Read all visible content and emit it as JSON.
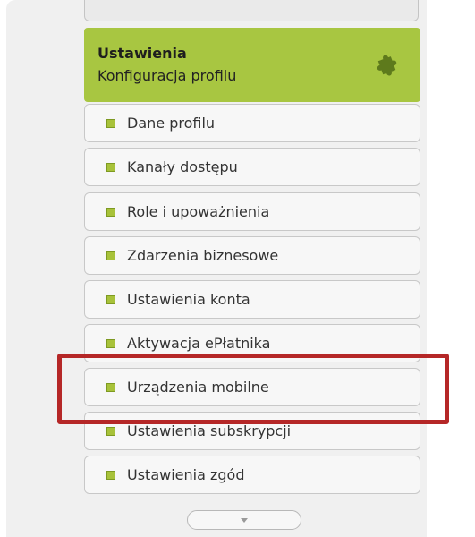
{
  "section": {
    "title": "Ustawienia",
    "subtitle": "Konfiguracja profilu",
    "icon": "puzzle-icon",
    "color": "#a8c641"
  },
  "menu": {
    "items": [
      {
        "label": "Dane profilu",
        "icon": "bullet-icon"
      },
      {
        "label": "Kanały dostępu",
        "icon": "bullet-icon"
      },
      {
        "label": "Role i upoważnienia",
        "icon": "bullet-icon"
      },
      {
        "label": "Zdarzenia biznesowe",
        "icon": "bullet-icon"
      },
      {
        "label": "Ustawienia konta",
        "icon": "bullet-icon"
      },
      {
        "label": "Aktywacja ePłatnika",
        "icon": "bullet-icon"
      },
      {
        "label": "Urządzenia mobilne",
        "icon": "bullet-icon"
      },
      {
        "label": "Ustawienia subskrypcji",
        "icon": "bullet-icon"
      },
      {
        "label": "Ustawienia zgód",
        "icon": "bullet-icon"
      }
    ],
    "highlighted_item": "Urządzenia mobilne",
    "highlight_color": "#b52727"
  },
  "more_button": {
    "icon": "chevron-down-icon"
  }
}
